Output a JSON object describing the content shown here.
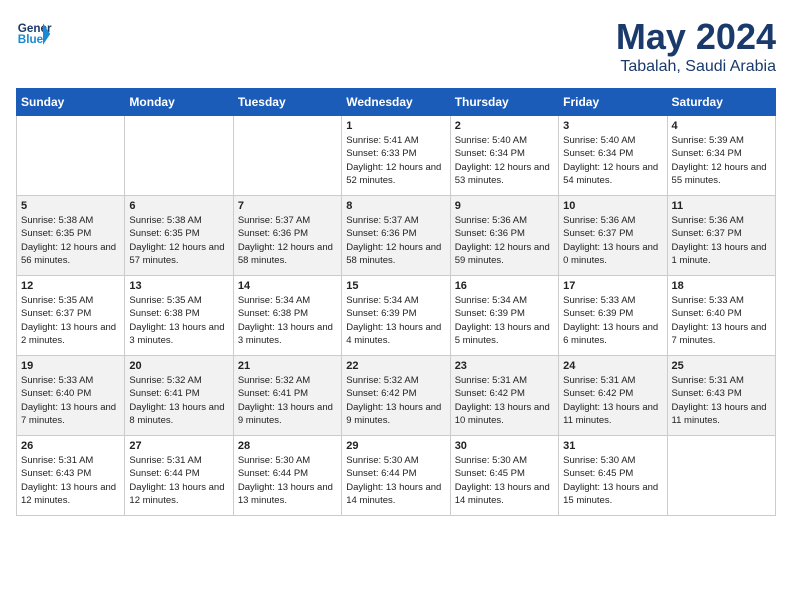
{
  "logo": {
    "text_general": "General",
    "text_blue": "Blue"
  },
  "calendar": {
    "title": "May 2024",
    "subtitle": "Tabalah, Saudi Arabia"
  },
  "days_of_week": [
    "Sunday",
    "Monday",
    "Tuesday",
    "Wednesday",
    "Thursday",
    "Friday",
    "Saturday"
  ],
  "weeks": [
    [
      {
        "day": "",
        "info": ""
      },
      {
        "day": "",
        "info": ""
      },
      {
        "day": "",
        "info": ""
      },
      {
        "day": "1",
        "info": "Sunrise: 5:41 AM\nSunset: 6:33 PM\nDaylight: 12 hours\nand 52 minutes."
      },
      {
        "day": "2",
        "info": "Sunrise: 5:40 AM\nSunset: 6:34 PM\nDaylight: 12 hours\nand 53 minutes."
      },
      {
        "day": "3",
        "info": "Sunrise: 5:40 AM\nSunset: 6:34 PM\nDaylight: 12 hours\nand 54 minutes."
      },
      {
        "day": "4",
        "info": "Sunrise: 5:39 AM\nSunset: 6:34 PM\nDaylight: 12 hours\nand 55 minutes."
      }
    ],
    [
      {
        "day": "5",
        "info": "Sunrise: 5:38 AM\nSunset: 6:35 PM\nDaylight: 12 hours\nand 56 minutes."
      },
      {
        "day": "6",
        "info": "Sunrise: 5:38 AM\nSunset: 6:35 PM\nDaylight: 12 hours\nand 57 minutes."
      },
      {
        "day": "7",
        "info": "Sunrise: 5:37 AM\nSunset: 6:36 PM\nDaylight: 12 hours\nand 58 minutes."
      },
      {
        "day": "8",
        "info": "Sunrise: 5:37 AM\nSunset: 6:36 PM\nDaylight: 12 hours\nand 58 minutes."
      },
      {
        "day": "9",
        "info": "Sunrise: 5:36 AM\nSunset: 6:36 PM\nDaylight: 12 hours\nand 59 minutes."
      },
      {
        "day": "10",
        "info": "Sunrise: 5:36 AM\nSunset: 6:37 PM\nDaylight: 13 hours\nand 0 minutes."
      },
      {
        "day": "11",
        "info": "Sunrise: 5:36 AM\nSunset: 6:37 PM\nDaylight: 13 hours\nand 1 minute."
      }
    ],
    [
      {
        "day": "12",
        "info": "Sunrise: 5:35 AM\nSunset: 6:37 PM\nDaylight: 13 hours\nand 2 minutes."
      },
      {
        "day": "13",
        "info": "Sunrise: 5:35 AM\nSunset: 6:38 PM\nDaylight: 13 hours\nand 3 minutes."
      },
      {
        "day": "14",
        "info": "Sunrise: 5:34 AM\nSunset: 6:38 PM\nDaylight: 13 hours\nand 3 minutes."
      },
      {
        "day": "15",
        "info": "Sunrise: 5:34 AM\nSunset: 6:39 PM\nDaylight: 13 hours\nand 4 minutes."
      },
      {
        "day": "16",
        "info": "Sunrise: 5:34 AM\nSunset: 6:39 PM\nDaylight: 13 hours\nand 5 minutes."
      },
      {
        "day": "17",
        "info": "Sunrise: 5:33 AM\nSunset: 6:39 PM\nDaylight: 13 hours\nand 6 minutes."
      },
      {
        "day": "18",
        "info": "Sunrise: 5:33 AM\nSunset: 6:40 PM\nDaylight: 13 hours\nand 7 minutes."
      }
    ],
    [
      {
        "day": "19",
        "info": "Sunrise: 5:33 AM\nSunset: 6:40 PM\nDaylight: 13 hours\nand 7 minutes."
      },
      {
        "day": "20",
        "info": "Sunrise: 5:32 AM\nSunset: 6:41 PM\nDaylight: 13 hours\nand 8 minutes."
      },
      {
        "day": "21",
        "info": "Sunrise: 5:32 AM\nSunset: 6:41 PM\nDaylight: 13 hours\nand 9 minutes."
      },
      {
        "day": "22",
        "info": "Sunrise: 5:32 AM\nSunset: 6:42 PM\nDaylight: 13 hours\nand 9 minutes."
      },
      {
        "day": "23",
        "info": "Sunrise: 5:31 AM\nSunset: 6:42 PM\nDaylight: 13 hours\nand 10 minutes."
      },
      {
        "day": "24",
        "info": "Sunrise: 5:31 AM\nSunset: 6:42 PM\nDaylight: 13 hours\nand 11 minutes."
      },
      {
        "day": "25",
        "info": "Sunrise: 5:31 AM\nSunset: 6:43 PM\nDaylight: 13 hours\nand 11 minutes."
      }
    ],
    [
      {
        "day": "26",
        "info": "Sunrise: 5:31 AM\nSunset: 6:43 PM\nDaylight: 13 hours\nand 12 minutes."
      },
      {
        "day": "27",
        "info": "Sunrise: 5:31 AM\nSunset: 6:44 PM\nDaylight: 13 hours\nand 12 minutes."
      },
      {
        "day": "28",
        "info": "Sunrise: 5:30 AM\nSunset: 6:44 PM\nDaylight: 13 hours\nand 13 minutes."
      },
      {
        "day": "29",
        "info": "Sunrise: 5:30 AM\nSunset: 6:44 PM\nDaylight: 13 hours\nand 14 minutes."
      },
      {
        "day": "30",
        "info": "Sunrise: 5:30 AM\nSunset: 6:45 PM\nDaylight: 13 hours\nand 14 minutes."
      },
      {
        "day": "31",
        "info": "Sunrise: 5:30 AM\nSunset: 6:45 PM\nDaylight: 13 hours\nand 15 minutes."
      },
      {
        "day": "",
        "info": ""
      }
    ]
  ]
}
